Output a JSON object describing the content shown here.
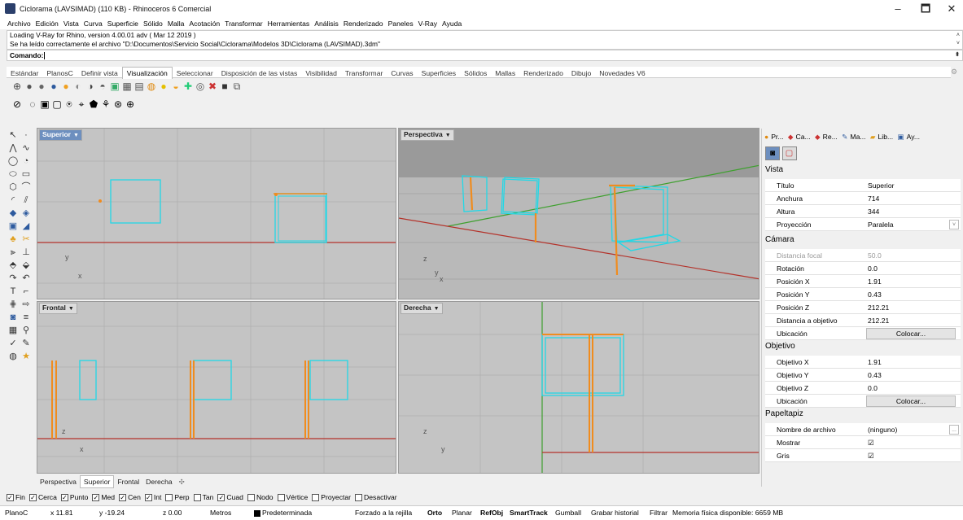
{
  "window": {
    "title": "Ciclorama (LAVSIMAD) (110 KB) - Rhinoceros 6 Comercial",
    "minimize_label": "–",
    "maximize_label": "🗖",
    "close_label": "✕"
  },
  "menu": [
    "Archivo",
    "Edición",
    "Vista",
    "Curva",
    "Superficie",
    "Sólido",
    "Malla",
    "Acotación",
    "Transformar",
    "Herramientas",
    "Análisis",
    "Renderizado",
    "Paneles",
    "V-Ray",
    "Ayuda"
  ],
  "command_history": [
    "Loading V-Ray for Rhino, version 4.00.01 adv ( Mar 12 2019 )",
    "Se ha leído correctamente el archivo \"D:\\Documentos\\Servicio Social\\Ciclorama\\Modelos 3D\\Ciclorama (LAVSIMAD).3dm\""
  ],
  "command_prompt": "Comando:",
  "toolbar_tabs": [
    "Estándar",
    "PlanosC",
    "Definir vista",
    "Visualización",
    "Seleccionar",
    "Disposición de las vistas",
    "Visibilidad",
    "Transformar",
    "Curvas",
    "Superficies",
    "Sólidos",
    "Mallas",
    "Renderizado",
    "Dibujo",
    "Novedades V6"
  ],
  "active_toolbar_tab": "Visualización",
  "viewports": {
    "top": {
      "label": "Superior"
    },
    "perspective": {
      "label": "Perspectiva"
    },
    "front": {
      "label": "Frontal"
    },
    "right": {
      "label": "Derecha"
    },
    "axis_x": "x",
    "axis_y": "y",
    "axis_z": "z"
  },
  "view_tabs": [
    "Perspectiva",
    "Superior",
    "Frontal",
    "Derecha"
  ],
  "active_view_tab": "Superior",
  "osnaps": [
    {
      "label": "Fin",
      "checked": true
    },
    {
      "label": "Cerca",
      "checked": true
    },
    {
      "label": "Punto",
      "checked": true
    },
    {
      "label": "Med",
      "checked": true
    },
    {
      "label": "Cen",
      "checked": true
    },
    {
      "label": "Int",
      "checked": true
    },
    {
      "label": "Perp",
      "checked": false
    },
    {
      "label": "Tan",
      "checked": false
    },
    {
      "label": "Cuad",
      "checked": true
    },
    {
      "label": "Nodo",
      "checked": false
    },
    {
      "label": "Vértice",
      "checked": false
    },
    {
      "label": "Proyectar",
      "checked": false
    },
    {
      "label": "Desactivar",
      "checked": false
    }
  ],
  "status": {
    "cplane": "PlanoC",
    "x": "x 11.81",
    "y": "y -19.24",
    "z": "z 0.00",
    "units": "Metros",
    "layer": "Predeterminada",
    "grid_snap": "Forzado a la rejilla",
    "ortho": "Orto",
    "planar": "Planar",
    "osnap": "RefObj",
    "smarttrack": "SmartTrack",
    "gumball": "Gumball",
    "history": "Grabar historial",
    "filter": "Filtrar",
    "memory": "Memoria física disponible: 6659 MB"
  },
  "panel": {
    "tabs": [
      "Pr...",
      "Ca...",
      "Re...",
      "Ma...",
      "Lib...",
      "Ay..."
    ],
    "section_vista": "Vista",
    "vista_rows": [
      {
        "k": "Título",
        "v": "Superior"
      },
      {
        "k": "Anchura",
        "v": "714"
      },
      {
        "k": "Altura",
        "v": "344"
      },
      {
        "k": "Proyección",
        "v": "Paralela"
      }
    ],
    "section_camara": "Cámara",
    "camara_rows": [
      {
        "k": "Distancia focal",
        "v": "50.0"
      },
      {
        "k": "Rotación",
        "v": "0.0"
      },
      {
        "k": "Posición X",
        "v": "1.91"
      },
      {
        "k": "Posición Y",
        "v": "0.43"
      },
      {
        "k": "Posición Z",
        "v": "212.21"
      },
      {
        "k": "Distancia a objetivo",
        "v": "212.21"
      },
      {
        "k": "Ubicación",
        "v": "Colocar..."
      }
    ],
    "section_objetivo": "Objetivo",
    "objetivo_rows": [
      {
        "k": "Objetivo X",
        "v": "1.91"
      },
      {
        "k": "Objetivo Y",
        "v": "0.43"
      },
      {
        "k": "Objetivo Z",
        "v": "0.0"
      },
      {
        "k": "Ubicación",
        "v": "Colocar..."
      }
    ],
    "section_papel": "Papeltapiz",
    "papel_rows": [
      {
        "k": "Nombre de archivo",
        "v": "(ninguno)"
      },
      {
        "k": "Mostrar",
        "v": "☑"
      },
      {
        "k": "Gris",
        "v": "☑"
      }
    ],
    "browse_label": "...",
    "colors": {
      "accent": "#6d8fbf",
      "cyan": "#22d8e6",
      "orange": "#f08c1e",
      "red_axis": "#b4322a",
      "green_axis": "#3ea02e"
    }
  }
}
